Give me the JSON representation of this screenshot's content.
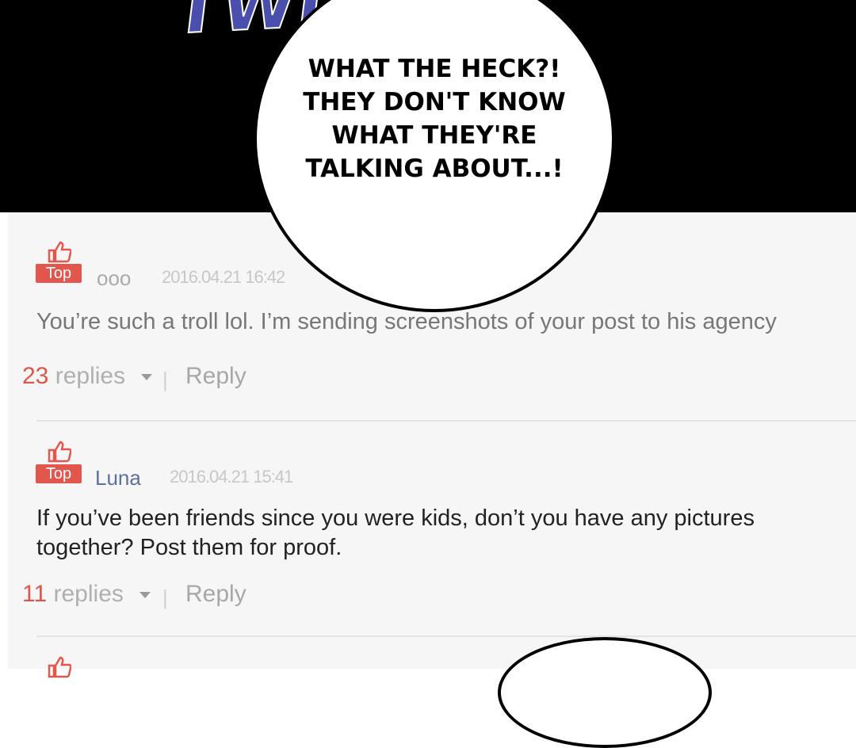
{
  "sfx": "TWITCH",
  "speech_bubble": "WHAT THE HECK?! THEY DON'T KNOW WHAT THEY'RE TALKING ABOUT...!",
  "colors": {
    "badge": "#e2564d",
    "reply_count": "#d9574b",
    "username_2": "#5c6f9e"
  },
  "comments": [
    {
      "badge": "Top",
      "username": "ooo",
      "timestamp": "2016.04.21 16:42",
      "body": "You’re such a troll lol. I’m sending screenshots of your post to his agency",
      "reply_count": "23",
      "replies_label": "replies",
      "reply_label": "Reply",
      "icon": "thumbs-up-icon"
    },
    {
      "badge": "Top",
      "username": "Luna",
      "timestamp": "2016.04.21 15:41",
      "body": "If you’ve been friends since you were kids, don’t you have any pictures together? Post them for proof.",
      "reply_count": "11",
      "replies_label": "replies",
      "reply_label": "Reply",
      "icon": "thumbs-up-icon"
    }
  ]
}
